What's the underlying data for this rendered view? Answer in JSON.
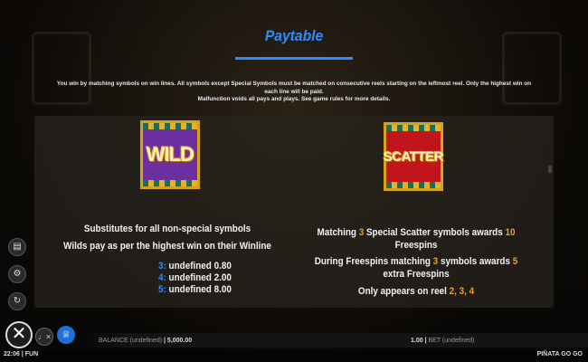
{
  "header": {
    "title": "Paytable"
  },
  "intro": {
    "line1": "You win by matching symbols on win lines. All symbols except Special Symbols must be matched on consecutive reels starting on the leftmost reel. Only the highest win on each line will be paid.",
    "line2": "Malfunction voids all pays and plays. See game rules for more details."
  },
  "wild": {
    "symbol_text": "WILD",
    "desc1": "Substitutes for all non-special symbols",
    "desc2": "Wilds pay as per the highest win on their Winline",
    "pays": [
      {
        "count": "3:",
        "label": "undefined",
        "value": "0.80"
      },
      {
        "count": "4:",
        "label": "undefined",
        "value": "2.00"
      },
      {
        "count": "5:",
        "label": "undefined",
        "value": "8.00"
      }
    ]
  },
  "scatter": {
    "symbol_text": "SCATTER",
    "line1_a": "Matching ",
    "line1_n": "3",
    "line1_b": " Special Scatter symbols awards ",
    "line1_v": "10",
    "line1_c": "Freespins",
    "line2_a": "During Freespins matching ",
    "line2_n": "3",
    "line2_b": " symbols awards ",
    "line2_v": "5",
    "line2_c": "extra Freespins",
    "line3_a": "Only appears on reel ",
    "line3_v": "2, 3, 4"
  },
  "controls": {
    "icons": [
      "document-icon",
      "gear-icon",
      "history-icon",
      "close-icon",
      "mute-icon",
      "trophy-icon"
    ]
  },
  "bottom_bar": {
    "balance_label": "BALANCE (undefined)",
    "balance_sep": "|",
    "balance_value": "5,000.00",
    "bet_value": "1.00",
    "bet_sep": "|",
    "bet_label": "BET (undefined)"
  },
  "status_bar": {
    "time": "22:06",
    "sep": "|",
    "mode": "FUN",
    "game_name": "PIÑATA GO GO"
  },
  "colors": {
    "accent": "#2f8cff",
    "highlight": "#f0a020"
  }
}
